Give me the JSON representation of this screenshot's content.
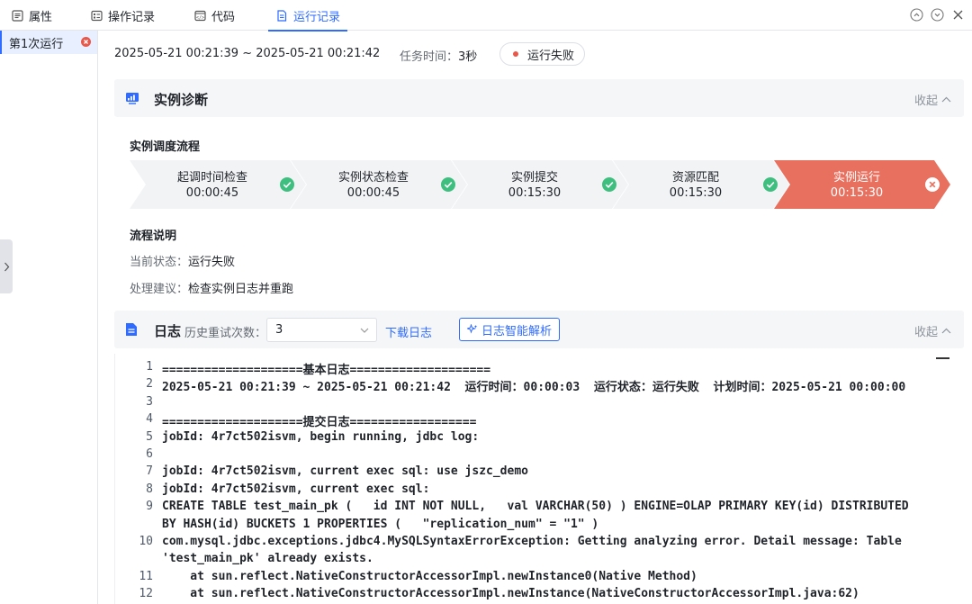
{
  "tabs": [
    {
      "label": "属性",
      "icon": "list-icon"
    },
    {
      "label": "操作记录",
      "icon": "record-icon"
    },
    {
      "label": "代码",
      "icon": "code-icon"
    },
    {
      "label": "运行记录",
      "icon": "doc-icon",
      "active": true
    }
  ],
  "window_controls": [
    "up-icon",
    "down-icon",
    "close-icon"
  ],
  "runs": [
    {
      "label": "第1次运行",
      "status": "failed"
    }
  ],
  "header": {
    "time_range": "2025-05-21 00:21:39 ~ 2025-05-21 00:21:42",
    "task_time_label": "任务时间：",
    "task_time_value": "3秒",
    "status": "运行失败"
  },
  "diagnosis": {
    "title": "实例诊断",
    "collapse": "收起",
    "flow_title": "实例调度流程",
    "steps": [
      {
        "name": "起调时间检查",
        "time": "00:00:45",
        "state": "ok"
      },
      {
        "name": "实例状态检查",
        "time": "00:00:45",
        "state": "ok"
      },
      {
        "name": "实例提交",
        "time": "00:15:30",
        "state": "ok"
      },
      {
        "name": "资源匹配",
        "time": "00:15:30",
        "state": "ok"
      },
      {
        "name": "实例运行",
        "time": "00:15:30",
        "state": "fail"
      }
    ],
    "desc_title": "流程说明",
    "current_state_label": "当前状态：",
    "current_state": "运行失败",
    "suggestion_label": "处理建议：",
    "suggestion": "检查实例日志并重跑"
  },
  "log": {
    "title": "日志",
    "retry_label": "历史重试次数：",
    "retry_value": "3",
    "download": "下载日志",
    "ai_button": "日志智能解析",
    "collapse": "收起",
    "lines": [
      {
        "n": "1",
        "text": "====================基本日志===================="
      },
      {
        "n": "2",
        "text": "2025-05-21 00:21:39 ~ 2025-05-21 00:21:42  运行时间：00:00:03  运行状态：运行失败  计划时间：2025-05-21 00:00:00"
      },
      {
        "n": "3",
        "text": ""
      },
      {
        "n": "4",
        "text": "====================提交日志=================="
      },
      {
        "n": "5",
        "text": "jobId: 4r7ct502isvm, begin running, jdbc log:"
      },
      {
        "n": "6",
        "text": ""
      },
      {
        "n": "7",
        "text": "jobId: 4r7ct502isvm, current exec sql: use jszc_demo"
      },
      {
        "n": "8",
        "text": "jobId: 4r7ct502isvm, current exec sql:"
      },
      {
        "n": "9",
        "text": "CREATE TABLE test_main_pk (   id INT NOT NULL,   val VARCHAR(50) ) ENGINE=OLAP PRIMARY KEY(id) DISTRIBUTED"
      },
      {
        "n": "",
        "text": "BY HASH(id) BUCKETS 1 PROPERTIES (   \"replication_num\" = \"1\" )"
      },
      {
        "n": "10",
        "text": "com.mysql.jdbc.exceptions.jdbc4.MySQLSyntaxErrorException: Getting analyzing error. Detail message: Table"
      },
      {
        "n": "",
        "text": "'test_main_pk' already exists."
      },
      {
        "n": "11",
        "text": "    at sun.reflect.NativeConstructorAccessorImpl.newInstance0(Native Method)"
      },
      {
        "n": "12",
        "text": "    at sun.reflect.NativeConstructorAccessorImpl.newInstance(NativeConstructorAccessorImpl.java:62)"
      }
    ]
  },
  "colors": {
    "accent": "#2f6bff",
    "success": "#3fbf7f",
    "fail": "#e8705f"
  }
}
